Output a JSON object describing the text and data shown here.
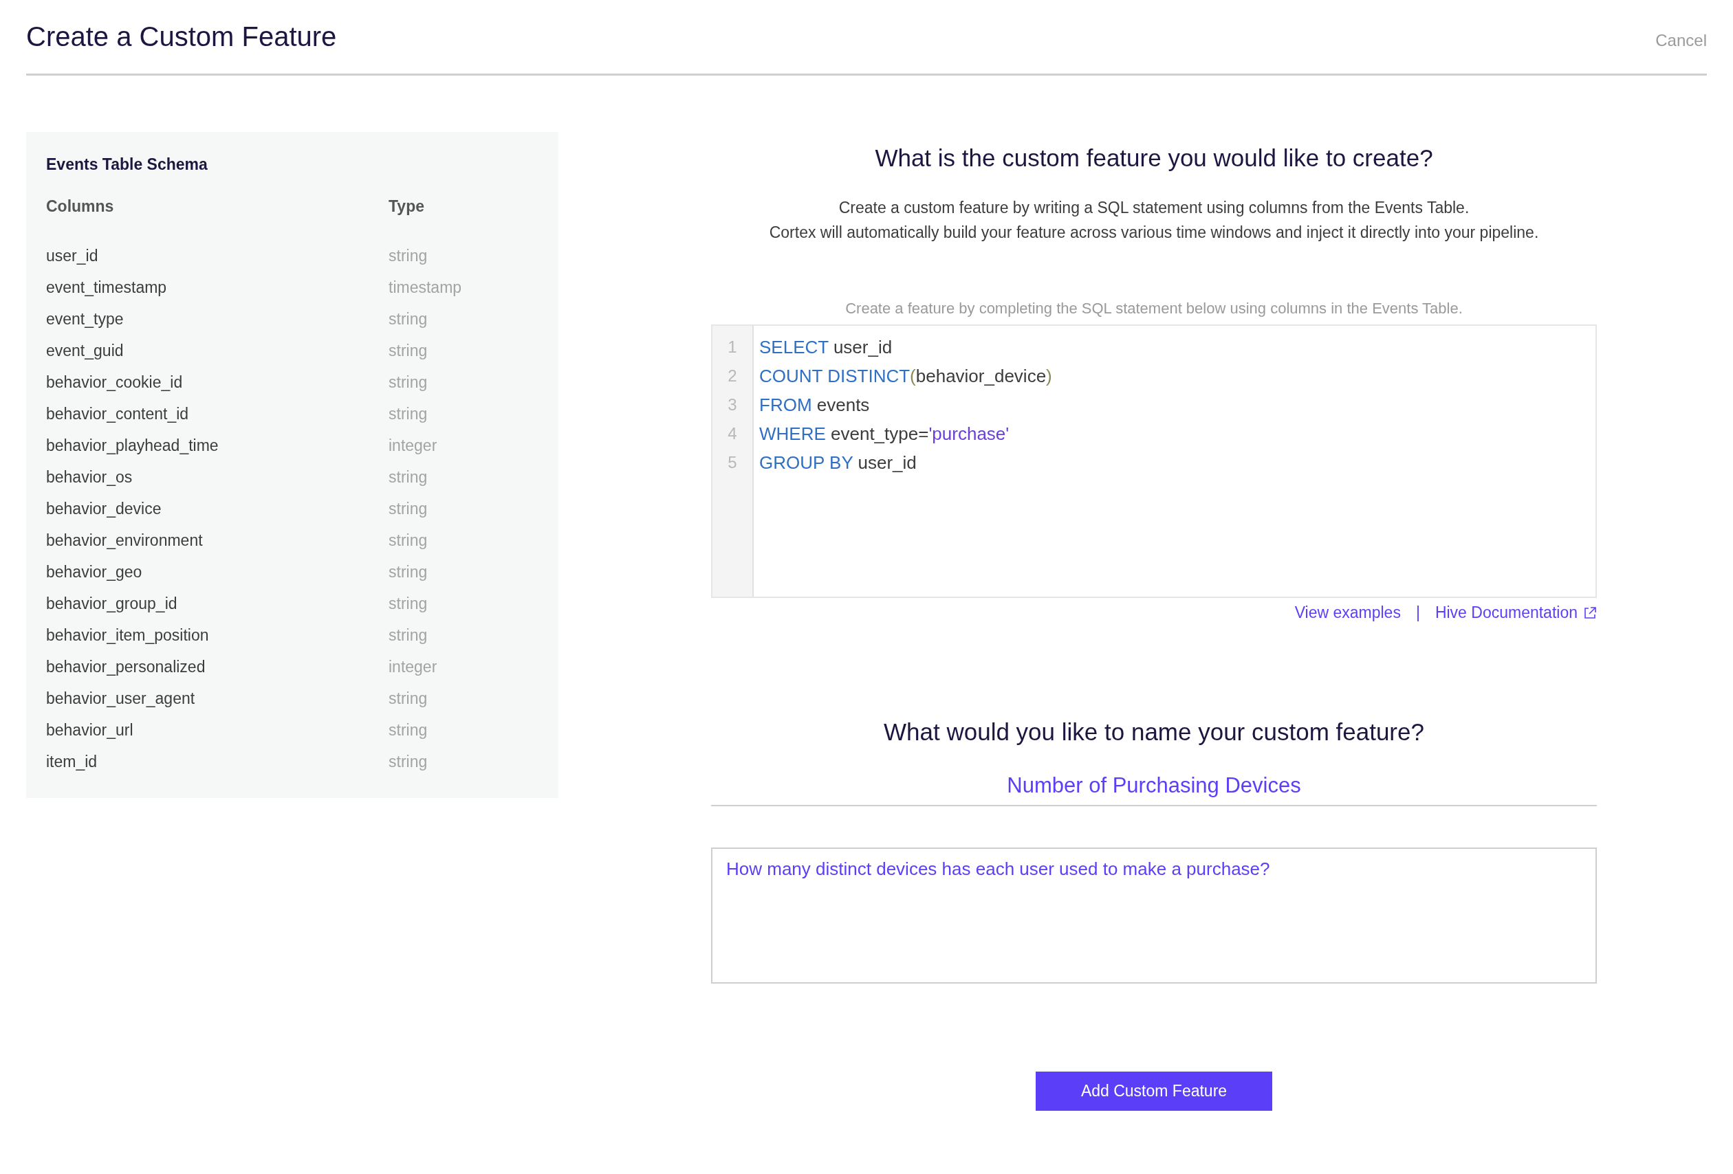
{
  "header": {
    "title": "Create a Custom Feature",
    "cancel": "Cancel"
  },
  "schema": {
    "title": "Events Table Schema",
    "columns": [
      "Columns",
      "Type"
    ],
    "rows": [
      {
        "name": "user_id",
        "type": "string"
      },
      {
        "name": "event_timestamp",
        "type": "timestamp"
      },
      {
        "name": "event_type",
        "type": "string"
      },
      {
        "name": "event_guid",
        "type": "string"
      },
      {
        "name": "behavior_cookie_id",
        "type": "string"
      },
      {
        "name": "behavior_content_id",
        "type": "string"
      },
      {
        "name": "behavior_playhead_time",
        "type": "integer"
      },
      {
        "name": "behavior_os",
        "type": "string"
      },
      {
        "name": "behavior_device",
        "type": "string"
      },
      {
        "name": "behavior_environment",
        "type": "string"
      },
      {
        "name": "behavior_geo",
        "type": "string"
      },
      {
        "name": "behavior_group_id",
        "type": "string"
      },
      {
        "name": "behavior_item_position",
        "type": "string"
      },
      {
        "name": "behavior_personalized",
        "type": "integer"
      },
      {
        "name": "behavior_user_agent",
        "type": "string"
      },
      {
        "name": "behavior_url",
        "type": "string"
      },
      {
        "name": "item_id",
        "type": "string"
      }
    ]
  },
  "definition": {
    "heading": "What is the custom feature you would like to create?",
    "description": [
      "Create a custom feature by writing a SQL statement using columns from the Events Table.",
      "Cortex will automatically build your feature across various time windows and inject it directly into your pipeline."
    ],
    "hint": "Create a feature by completing the SQL statement below using columns in the Events Table.",
    "editor": {
      "lines": [
        {
          "number": "1",
          "tokens": [
            {
              "kind": "keyword",
              "text": "SELECT"
            },
            {
              "kind": "plain",
              "text": " user_id"
            }
          ]
        },
        {
          "number": "2",
          "tokens": [
            {
              "kind": "keyword",
              "text": "COUNT DISTINCT"
            },
            {
              "kind": "paren",
              "text": "("
            },
            {
              "kind": "plain",
              "text": "behavior_device"
            },
            {
              "kind": "paren",
              "text": ")"
            }
          ]
        },
        {
          "number": "3",
          "tokens": [
            {
              "kind": "keyword",
              "text": "FROM"
            },
            {
              "kind": "plain",
              "text": " events"
            }
          ]
        },
        {
          "number": "4",
          "tokens": [
            {
              "kind": "keyword",
              "text": "WHERE"
            },
            {
              "kind": "plain",
              "text": " event_type="
            },
            {
              "kind": "string",
              "text": "'purchase'"
            }
          ]
        },
        {
          "number": "5",
          "tokens": [
            {
              "kind": "keyword",
              "text": "GROUP BY"
            },
            {
              "kind": "plain",
              "text": " user_id"
            }
          ]
        }
      ]
    },
    "links": {
      "examples": "View examples",
      "separator": "|",
      "docs": "Hive Documentation"
    }
  },
  "naming": {
    "heading": "What would you like to name your custom feature?",
    "name_value": "Number of Purchasing Devices",
    "description_value": "How many distinct devices has each user used to make a purchase?"
  },
  "submit": "Add Custom Feature"
}
